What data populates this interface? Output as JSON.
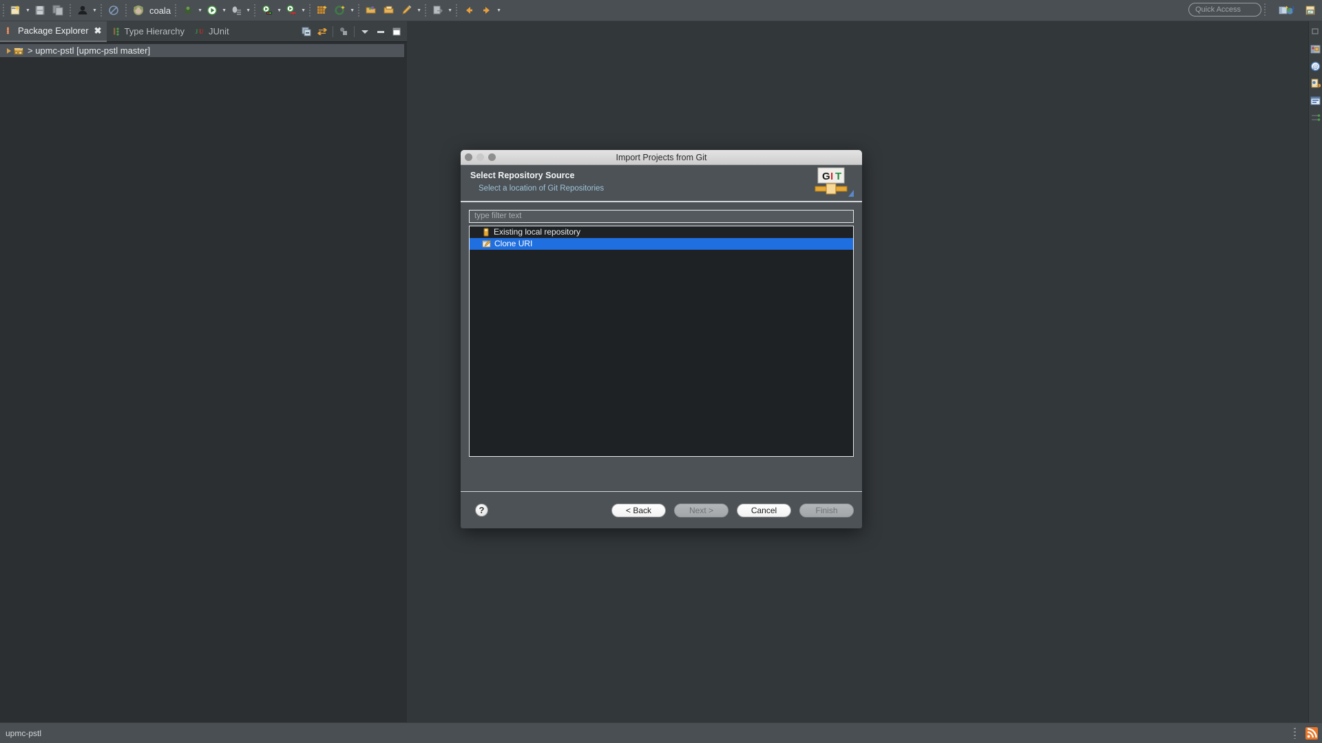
{
  "toolbar": {
    "icons": [
      {
        "name": "new-wizard-icon",
        "has_arrow": true
      },
      {
        "name": "save-icon",
        "has_arrow": false
      },
      {
        "name": "save-all-icon",
        "has_arrow": false
      },
      {
        "name": "user-icon",
        "has_arrow": true
      },
      {
        "name": "no-annotation-icon",
        "has_arrow": false
      },
      {
        "name": "coala-icon",
        "has_arrow": false
      },
      {
        "name": "debug-icon",
        "has_arrow": true
      },
      {
        "name": "run-icon",
        "has_arrow": true
      },
      {
        "name": "external-tools-icon",
        "has_arrow": true
      },
      {
        "name": "run-coverage-icon",
        "has_arrow": true
      },
      {
        "name": "run-server-icon",
        "has_arrow": true
      },
      {
        "name": "new-package-icon",
        "has_arrow": false
      },
      {
        "name": "new-class-icon",
        "has_arrow": true
      },
      {
        "name": "open-type-icon",
        "has_arrow": false
      },
      {
        "name": "open-task-icon",
        "has_arrow": false
      },
      {
        "name": "pencil-icon",
        "has_arrow": true
      },
      {
        "name": "export-icon",
        "has_arrow": true
      },
      {
        "name": "back-icon",
        "has_arrow": false
      },
      {
        "name": "forward-icon",
        "has_arrow": false
      }
    ],
    "coala_label": "coala",
    "quick_access_placeholder": "Quick Access",
    "perspective_icons": [
      "open-perspective-icon",
      "java-perspective-icon",
      "git-perspective-icon"
    ]
  },
  "explorer": {
    "tabs": [
      {
        "label": "Package Explorer",
        "icon": "package-explorer-icon",
        "active": true,
        "closable": true
      },
      {
        "label": "Type Hierarchy",
        "icon": "type-hierarchy-icon",
        "active": false,
        "closable": false
      },
      {
        "label": "JUnit",
        "icon": "junit-icon",
        "active": false,
        "closable": false
      }
    ],
    "close_glyph": "✖",
    "view_toolbar": [
      {
        "name": "collapse-all-icon"
      },
      {
        "name": "link-with-editor-icon"
      },
      {
        "name": "focus-on-active-task-icon"
      },
      {
        "name": "view-menu-icon"
      },
      {
        "name": "minimize-view-icon"
      },
      {
        "name": "maximize-view-icon"
      }
    ],
    "tree": [
      {
        "label": "> upmc-pstl [upmc-pstl master]",
        "icon": "java-project-icon",
        "expanded": false,
        "selected": true
      }
    ]
  },
  "right_bar": {
    "icons": [
      "restore-icon",
      "java-perspective-fastview-icon",
      "at-perspective-icon",
      "java-browsing-icon",
      "console-view-icon",
      "team-sync-icon"
    ]
  },
  "dialog": {
    "title": "Import Projects from Git",
    "traffic_lights": [
      "close",
      "minimize",
      "zoom"
    ],
    "header": {
      "title": "Select Repository Source",
      "subtitle": "Select a location of Git Repositories",
      "logo_text": "GIT",
      "logo_letters": [
        "G",
        "I",
        "T"
      ],
      "logo_colors": [
        "#1a1a1a",
        "#cf2a27",
        "#1f8a3c"
      ]
    },
    "filter": {
      "placeholder": "type filter text",
      "value": ""
    },
    "list": [
      {
        "label": "Existing local repository",
        "icon": "local-repository-icon",
        "selected": false
      },
      {
        "label": "Clone URI",
        "icon": "clone-uri-icon",
        "selected": true
      }
    ],
    "help_glyph": "?",
    "buttons": [
      {
        "label": "< Back",
        "enabled": true,
        "name": "back-button"
      },
      {
        "label": "Next >",
        "enabled": false,
        "name": "next-button"
      },
      {
        "label": "Cancel",
        "enabled": true,
        "name": "cancel-button"
      },
      {
        "label": "Finish",
        "enabled": false,
        "name": "finish-button"
      }
    ]
  },
  "statusbar": {
    "text": "upmc-pstl",
    "right_icon": "rss-feed-icon"
  },
  "colors": {
    "selection_blue": "#1f6fe0",
    "accent_orange": "#e8772a",
    "panel_bg": "#2b2f31",
    "toolbar_bg": "#4a4f53",
    "dialog_bg": "#4c5256"
  }
}
